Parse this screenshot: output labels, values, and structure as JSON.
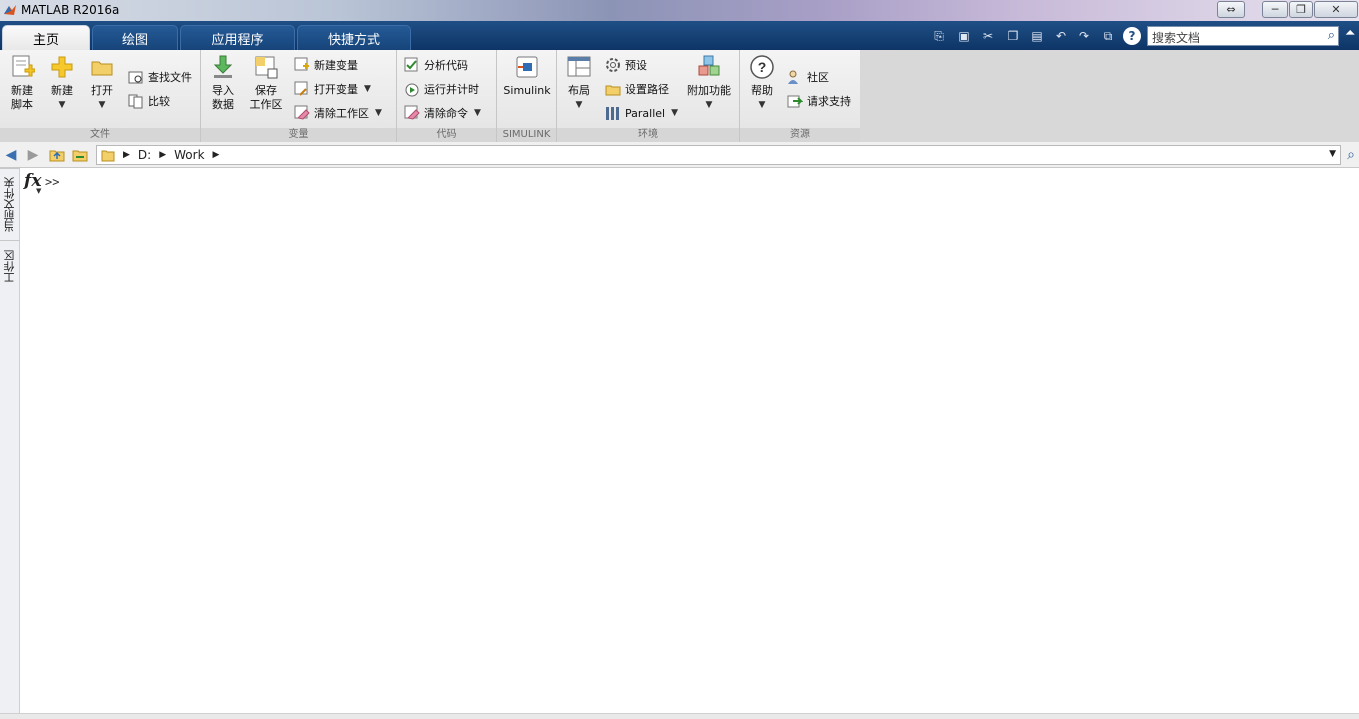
{
  "window": {
    "title": "MATLAB R2016a",
    "buttons": [
      "⇔",
      "─",
      "❐",
      "✕"
    ]
  },
  "tabs": [
    {
      "label": "主页",
      "active": true
    },
    {
      "label": "绘图",
      "active": false
    },
    {
      "label": "应用程序",
      "active": false
    },
    {
      "label": "快捷方式",
      "active": false
    }
  ],
  "search": {
    "placeholder": "搜索文档"
  },
  "ribbon": {
    "file": {
      "label": "文件",
      "new_script": "新建\n脚本",
      "new": "新建",
      "open": "打开",
      "find_files": "查找文件",
      "compare": "比较"
    },
    "variable": {
      "label": "变量",
      "import": "导入\n数据",
      "save_ws": "保存\n工作区",
      "new_var": "新建变量",
      "open_var": "打开变量",
      "clear_ws": "清除工作区"
    },
    "code": {
      "label": "代码",
      "analyze": "分析代码",
      "run_time": "运行并计时",
      "clear_cmd": "清除命令"
    },
    "simulink": {
      "label": "SIMULINK",
      "simulink": "Simulink"
    },
    "environment": {
      "label": "环境",
      "layout": "布局",
      "preferences": "预设",
      "set_path": "设置路径",
      "parallel": "Parallel",
      "addons": "附加功能"
    },
    "resources": {
      "label": "资源",
      "help": "帮助",
      "community": "社区",
      "support": "请求支持"
    }
  },
  "address": {
    "segments": [
      "D:",
      "Work"
    ]
  },
  "side_tabs": [
    "当前文件夹",
    "工作区"
  ],
  "command": {
    "fx": "fx",
    "prompt": ">>"
  },
  "colors": {
    "tabbar": "#1f4f86",
    "ribbon": "#eeeeee"
  }
}
